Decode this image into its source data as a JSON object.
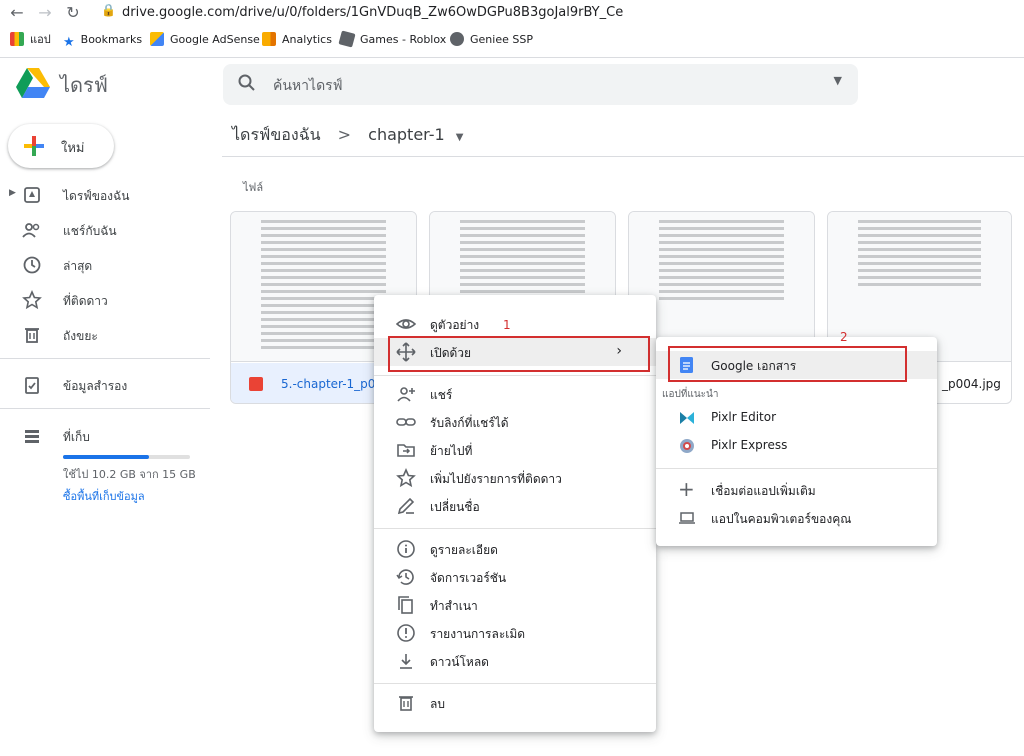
{
  "browser": {
    "url": "drive.google.com/drive/u/0/folders/1GnVDuqB_Zw6OwDGPu8B3goJal9rBY_Ce",
    "bookmarks": [
      "แอป",
      "Bookmarks",
      "Google AdSense",
      "Analytics",
      "Games - Roblox",
      "Geniee SSP"
    ]
  },
  "app": {
    "name": "ไดรฟ์",
    "search_placeholder": "ค้นหาไดรฟ์"
  },
  "sidebar": {
    "new_label": "ใหม่",
    "items": [
      {
        "label": "ไดรฟ์ของฉัน",
        "icon": "my-drive-icon"
      },
      {
        "label": "แชร์กับฉัน",
        "icon": "people-icon"
      },
      {
        "label": "ล่าสุด",
        "icon": "clock-icon"
      },
      {
        "label": "ที่ติดดาว",
        "icon": "star-icon"
      },
      {
        "label": "ถังขยะ",
        "icon": "trash-icon"
      },
      {
        "label": "ข้อมูลสำรอง",
        "icon": "backup-icon"
      },
      {
        "label": "ที่เก็บ",
        "icon": "storage-icon"
      }
    ],
    "storage": {
      "used_fraction": 0.68,
      "usage_text": "ใช้ไป 10.2 GB จาก 15 GB",
      "buy_link": "ซื้อพื้นที่เก็บข้อมูล"
    }
  },
  "main": {
    "breadcrumb_root": "ไดรฟ์ของฉัน",
    "breadcrumb_sep": ">",
    "breadcrumb_current": "chapter-1",
    "section_label": "ไฟล์",
    "files": [
      {
        "name": "5.-chapter-1_p001"
      },
      {
        "name": "_p004.jpg"
      }
    ]
  },
  "context_menu": {
    "items": [
      {
        "label": "ดูตัวอย่าง",
        "icon": "eye-icon"
      },
      {
        "label": "เปิดด้วย",
        "icon": "move-arrows-icon"
      },
      {
        "label": "แชร์",
        "icon": "person-add-icon"
      },
      {
        "label": "รับลิงก์ที่แชร์ได้",
        "icon": "link-icon"
      },
      {
        "label": "ย้ายไปที่",
        "icon": "folder-move-icon"
      },
      {
        "label": "เพิ่มไปยังรายการที่ติดดาว",
        "icon": "star-outline-icon"
      },
      {
        "label": "เปลี่ยนชื่อ",
        "icon": "pencil-icon"
      },
      {
        "label": "ดูรายละเอียด",
        "icon": "info-icon"
      },
      {
        "label": "จัดการเวอร์ชัน",
        "icon": "history-icon"
      },
      {
        "label": "ทำสำเนา",
        "icon": "copy-icon"
      },
      {
        "label": "รายงานการละเมิด",
        "icon": "report-icon"
      },
      {
        "label": "ดาวน์โหลด",
        "icon": "download-icon"
      },
      {
        "label": "ลบ",
        "icon": "trash-icon"
      }
    ],
    "chevron": "›"
  },
  "submenu": {
    "top_item": "Google เอกสาร",
    "suggested_header": "แอปที่แนะนำ",
    "apps": [
      "Pixlr Editor",
      "Pixlr Express"
    ],
    "connect_more": "เชื่อมต่อแอปเพิ่มเติม",
    "desktop_apps": "แอปในคอมพิวเตอร์ของคุณ"
  },
  "annotations": {
    "step1": "1",
    "step2": "2"
  },
  "colors": {
    "accent": "#1a73e8",
    "highlight": "#d32f2f"
  }
}
